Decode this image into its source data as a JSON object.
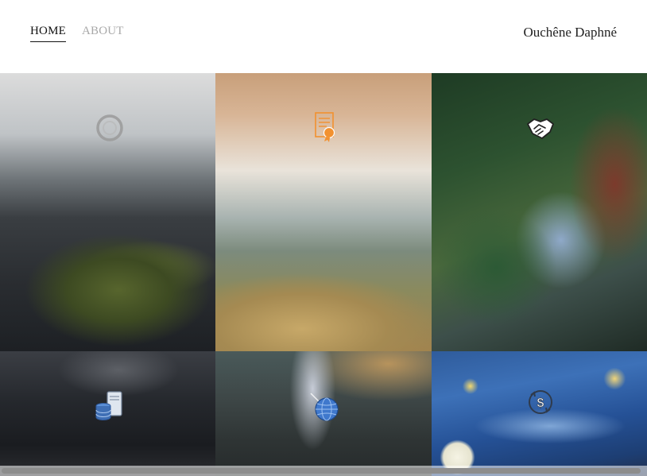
{
  "nav": {
    "items": [
      {
        "label": "HOME",
        "active": true
      },
      {
        "label": "ABOUT",
        "active": false
      }
    ]
  },
  "site": {
    "title": "Ouchêne Daphné"
  },
  "gallery": {
    "tiles": [
      {
        "icon": "power-icon",
        "icon_color": "#9a9a9a"
      },
      {
        "icon": "certificate-icon",
        "icon_color": "#f2912f"
      },
      {
        "icon": "handshake-icon",
        "icon_color": "#ffffff"
      },
      {
        "icon": "database-server-icon",
        "icon_color": "#3f6fb5"
      },
      {
        "icon": "network-globe-icon",
        "icon_color": "#4a84d6"
      },
      {
        "icon": "currency-exchange-icon",
        "icon_color": "#2f3b4d"
      }
    ]
  },
  "colors": {
    "text": "#111111",
    "nav_inactive": "#a8a8a8",
    "scrollbar": "#8d8d8d"
  }
}
